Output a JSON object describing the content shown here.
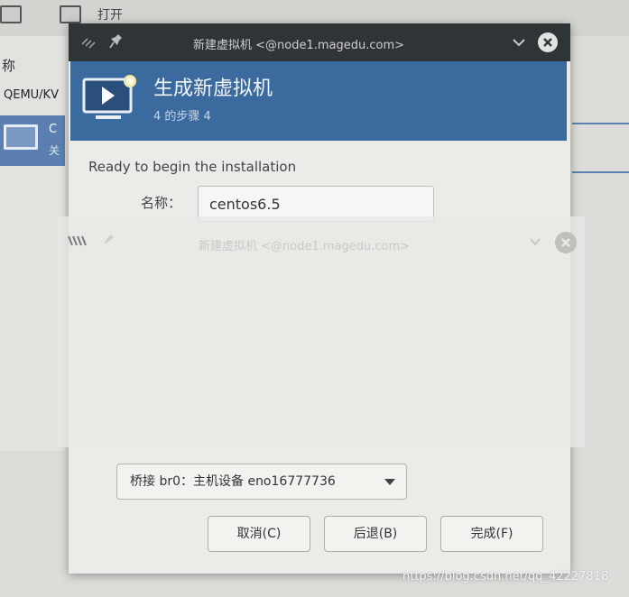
{
  "background_app": {
    "toolbar_open": "打开",
    "column_name": "称",
    "connection": "QEMU/KV",
    "vm_row": {
      "name_fragment": "C",
      "status_fragment": "关"
    }
  },
  "dialog": {
    "title": "新建虚拟机 <@node1.magedu.com>",
    "header": {
      "title": "生成新虚拟机",
      "step": "4 的步骤 4"
    },
    "ready_text": "Ready to begin the installation",
    "name_label": "名称：",
    "name_value": "centos6.5",
    "network_selection": "桥接 br0：主机设备 eno16777736",
    "buttons": {
      "cancel": "取消(C)",
      "back": "后退(B)",
      "finish": "完成(F)"
    }
  },
  "ghost_dialog": {
    "title": "新建虚拟机 <@node1.magedu.com>"
  },
  "watermark": "https://blog.csdn.net/qq_42227818",
  "colors": {
    "titlebar": "#2f3437",
    "header_blue": "#3a6a9e",
    "dialog_bg": "#ebebe8",
    "selection_blue": "#5b7fb0"
  }
}
